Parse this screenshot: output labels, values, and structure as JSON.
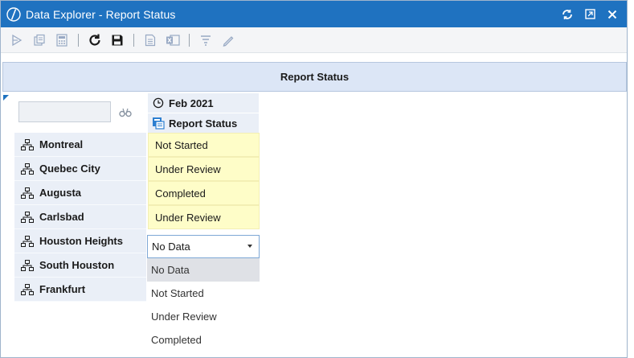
{
  "window": {
    "title": "Data Explorer - Report Status",
    "logo_icon": "app-logo-icon",
    "controls": [
      {
        "icon": "refresh-icon"
      },
      {
        "icon": "popout-icon"
      },
      {
        "icon": "close-icon"
      }
    ]
  },
  "toolbar": {
    "buttons": [
      {
        "icon": "navigate-icon"
      },
      {
        "icon": "copy-icon"
      },
      {
        "icon": "calculator-icon"
      },
      {
        "icon": "refresh-icon"
      },
      {
        "icon": "save-icon"
      },
      {
        "icon": "document-icon"
      },
      {
        "icon": "excel-icon"
      },
      {
        "icon": "filter-icon"
      },
      {
        "icon": "edit-icon"
      }
    ]
  },
  "report": {
    "header": "Report Status",
    "filter": {
      "value": "",
      "button_icon": "search-filter-icon"
    },
    "columns": {
      "period": "Feb 2021",
      "period_icon": "clock-icon",
      "measure": "Report Status",
      "measure_icon": "report-icon"
    },
    "rows": [
      {
        "label": "Montreal",
        "value": "Not Started"
      },
      {
        "label": "Quebec City",
        "value": "Under Review"
      },
      {
        "label": "Augusta",
        "value": "Completed"
      },
      {
        "label": "Carlsbad",
        "value": "Under Review"
      },
      {
        "label": "Houston Heights",
        "value": "No Data"
      },
      {
        "label": "South Houston",
        "value": ""
      },
      {
        "label": "Frankfurt",
        "value": ""
      }
    ],
    "row_icon": "hierarchy-icon",
    "dropdown": {
      "selected": "No Data",
      "options": [
        "No Data",
        "Not Started",
        "Under Review",
        "Completed"
      ]
    }
  },
  "colors": {
    "titlebar": "#1f72c0",
    "header_bg": "#dce6f6",
    "cell_fill": "#fefdc8",
    "row_header_bg": "#eaeff7"
  }
}
